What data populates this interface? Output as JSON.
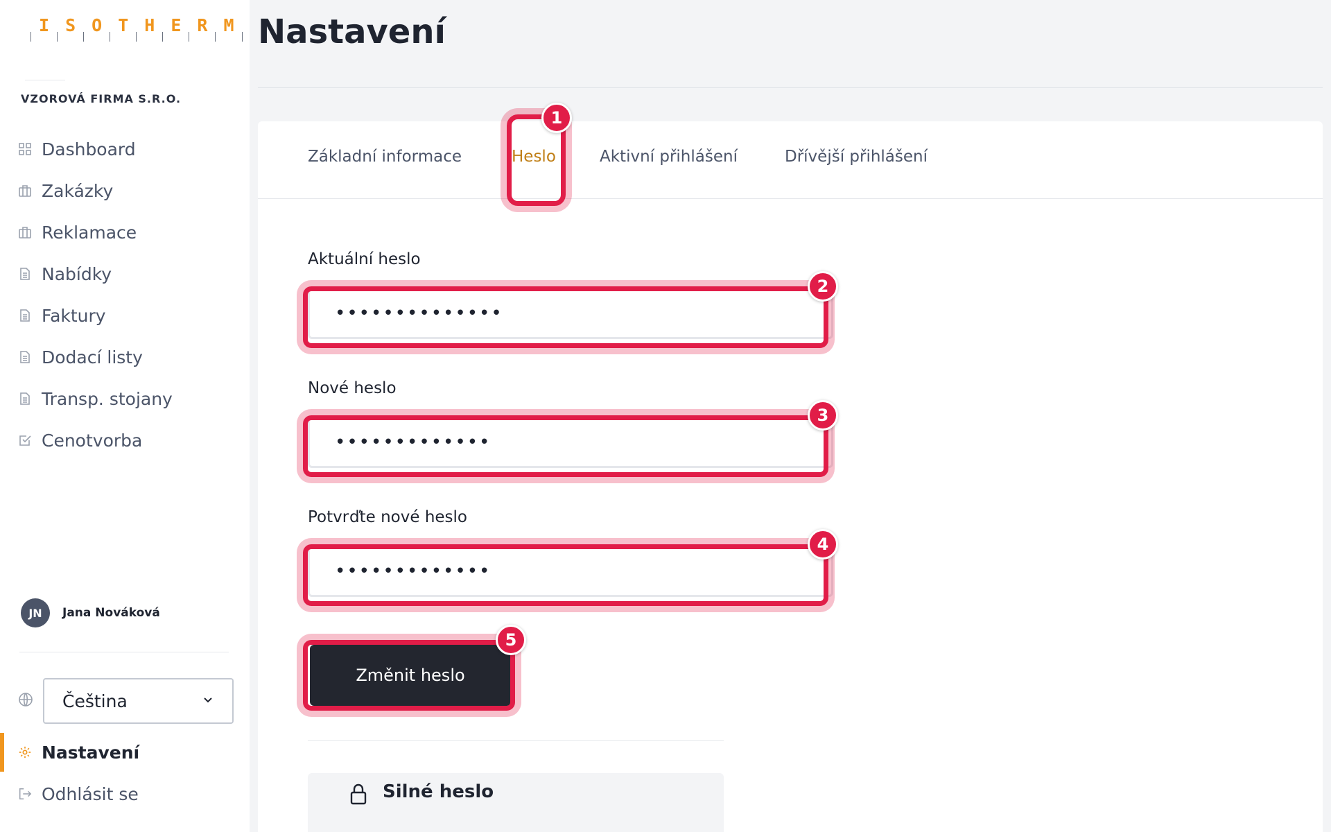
{
  "logo": {
    "letters": [
      "I",
      "S",
      "O",
      "T",
      "H",
      "E",
      "R",
      "M"
    ]
  },
  "company_name": "VZOROVÁ FIRMA S.R.O.",
  "sidebar": {
    "items": [
      {
        "label": "Dashboard",
        "icon": "grid-icon"
      },
      {
        "label": "Zakázky",
        "icon": "briefcase-icon"
      },
      {
        "label": "Reklamace",
        "icon": "briefcase-icon"
      },
      {
        "label": "Nabídky",
        "icon": "document-icon"
      },
      {
        "label": "Faktury",
        "icon": "document-icon"
      },
      {
        "label": "Dodací listy",
        "icon": "document-icon"
      },
      {
        "label": "Transp. stojany",
        "icon": "document-icon"
      },
      {
        "label": "Cenotvorba",
        "icon": "checkbox-icon"
      }
    ],
    "settings_label": "Nastavení",
    "logout_label": "Odhlásit se"
  },
  "user": {
    "initials": "JN",
    "name": "Jana Nováková"
  },
  "language": {
    "selected": "Čeština",
    "icon": "globe-icon"
  },
  "page": {
    "title": "Nastavení"
  },
  "tabs": [
    {
      "label": "Základní informace",
      "active": false
    },
    {
      "label": "Heslo",
      "active": true
    },
    {
      "label": "Aktivní přihlášení",
      "active": false
    },
    {
      "label": "Dřívější přihlášení",
      "active": false
    }
  ],
  "form": {
    "current_label": "Aktuální heslo",
    "current_value": "••••••••••••••",
    "new_label": "Nové heslo",
    "new_value": "•••••••••••••",
    "confirm_label": "Potvrďte nové heslo",
    "confirm_value": "•••••••••••••",
    "submit_label": "Změnit heslo"
  },
  "strong_password": {
    "title": "Silné heslo"
  },
  "annotations": [
    "1",
    "2",
    "3",
    "4",
    "5"
  ],
  "colors": {
    "accent": "#f0961e",
    "highlight": "#e11d48",
    "button": "#23262f"
  }
}
